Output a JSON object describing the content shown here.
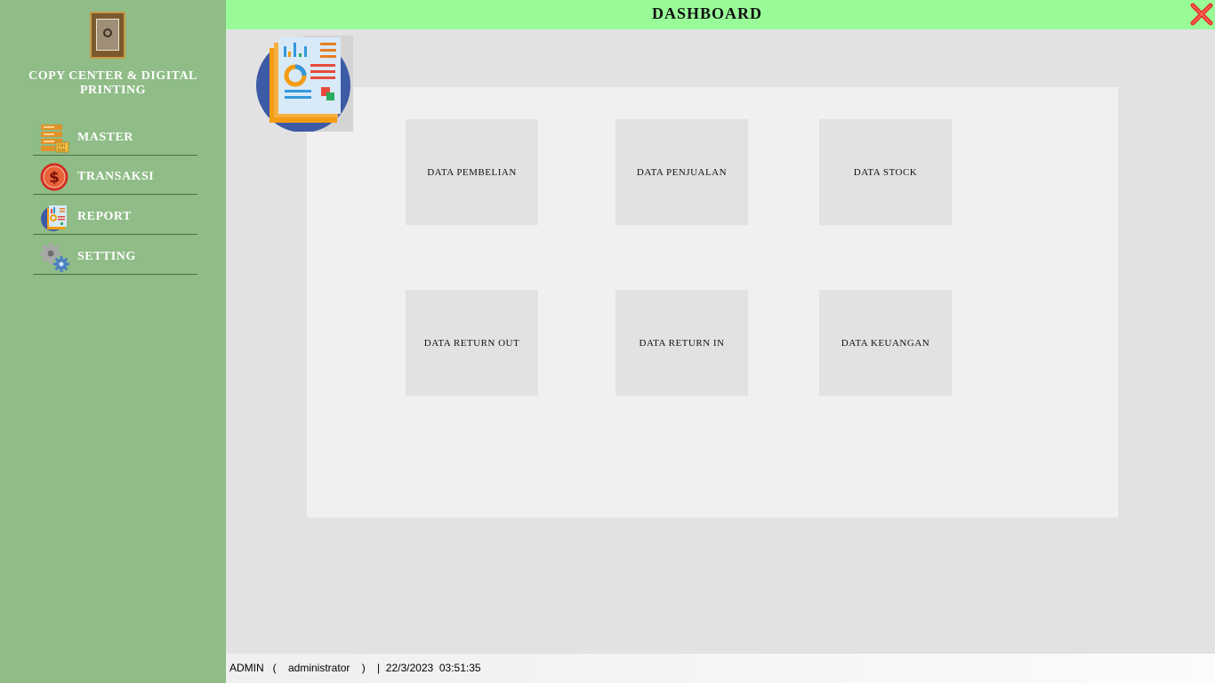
{
  "header": {
    "title": "DASHBOARD"
  },
  "sidebar": {
    "company_name": "COPY CENTER & DIGITAL PRINTING",
    "items": [
      {
        "label": "MASTER",
        "icon": "database-icon"
      },
      {
        "label": "TRANSAKSI",
        "icon": "dollar-icon"
      },
      {
        "label": "REPORT",
        "icon": "report-icon"
      },
      {
        "label": "SETTING",
        "icon": "gear-icon"
      }
    ]
  },
  "tiles": [
    {
      "label": "DATA PEMBELIAN"
    },
    {
      "label": "DATA PENJUALAN"
    },
    {
      "label": "DATA STOCK"
    },
    {
      "label": "DATA RETURN OUT"
    },
    {
      "label": "DATA RETURN IN"
    },
    {
      "label": "DATA KEUANGAN"
    }
  ],
  "status": {
    "text": "ADMIN   (    administrator    )    |  22/3/2023  03:51:35"
  },
  "colors": {
    "sidebar": "#8fbc87",
    "topbar": "#98fb98",
    "close": "#e8302a"
  }
}
